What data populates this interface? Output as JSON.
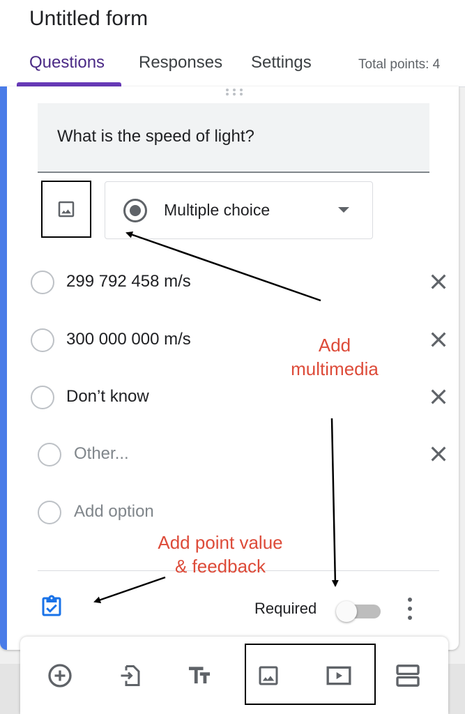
{
  "header": {
    "form_title": "Untitled form",
    "tabs": [
      "Questions",
      "Responses",
      "Settings"
    ],
    "active_tab": "Questions",
    "total_points": "Total points: 4",
    "accent_color": "#673ab7"
  },
  "question": {
    "title": "What is the speed of light?",
    "type": "Multiple choice",
    "options": [
      "299 792 458 m/s",
      "300 000 000 m/s",
      "Don’t know"
    ],
    "other_placeholder": "Other...",
    "add_option_placeholder": "Add option",
    "required_label": "Required",
    "required": false,
    "card_accent_color": "#4a7ce8"
  },
  "annotations": {
    "multimedia_line1": "Add",
    "multimedia_line2": "multimedia",
    "points_line1": "Add point value",
    "points_line2": "& feedback",
    "color": "#dd4b39"
  },
  "toolbar": {
    "icons": [
      "add-question-icon",
      "import-questions-icon",
      "add-title-icon",
      "add-image-icon",
      "add-video-icon",
      "add-section-icon"
    ]
  }
}
